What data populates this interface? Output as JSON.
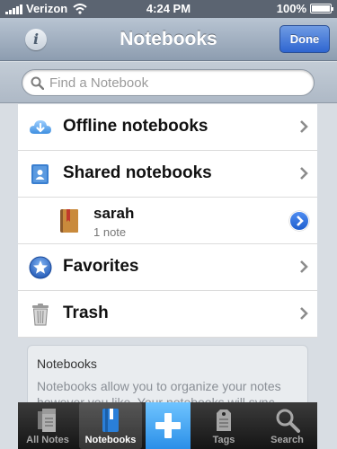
{
  "status": {
    "carrier": "Verizon",
    "time": "4:24 PM",
    "battery": "100%",
    "battery_level": 1.0
  },
  "nav": {
    "title": "Notebooks",
    "done_label": "Done",
    "info_label": "i"
  },
  "search": {
    "placeholder": "Find a Notebook"
  },
  "list": [
    {
      "label": "Offline notebooks",
      "icon": "cloud-download-icon"
    },
    {
      "label": "Shared notebooks",
      "icon": "shared-notebook-icon"
    },
    {
      "label": "sarah",
      "subtitle": "1 note",
      "icon": "notebook-icon",
      "accessory": "disclosure-button"
    },
    {
      "label": "Favorites",
      "icon": "star-icon"
    },
    {
      "label": "Trash",
      "icon": "trash-icon"
    }
  ],
  "info": {
    "title": "Notebooks",
    "description": "Notebooks allow you to organize your notes however you like. Your notebooks will sync"
  },
  "tabs": [
    {
      "label": "All Notes",
      "icon": "notes-icon",
      "active": false
    },
    {
      "label": "Notebooks",
      "icon": "notebook-icon",
      "active": true
    },
    {
      "label": "",
      "icon": "plus-icon",
      "active": false
    },
    {
      "label": "Tags",
      "icon": "tag-icon",
      "active": false
    },
    {
      "label": "Search",
      "icon": "search-icon",
      "active": false
    }
  ],
  "colors": {
    "accent": "#2f66d1",
    "add_button": "#2b8fe8",
    "tabbar": "#1f1f1f"
  }
}
